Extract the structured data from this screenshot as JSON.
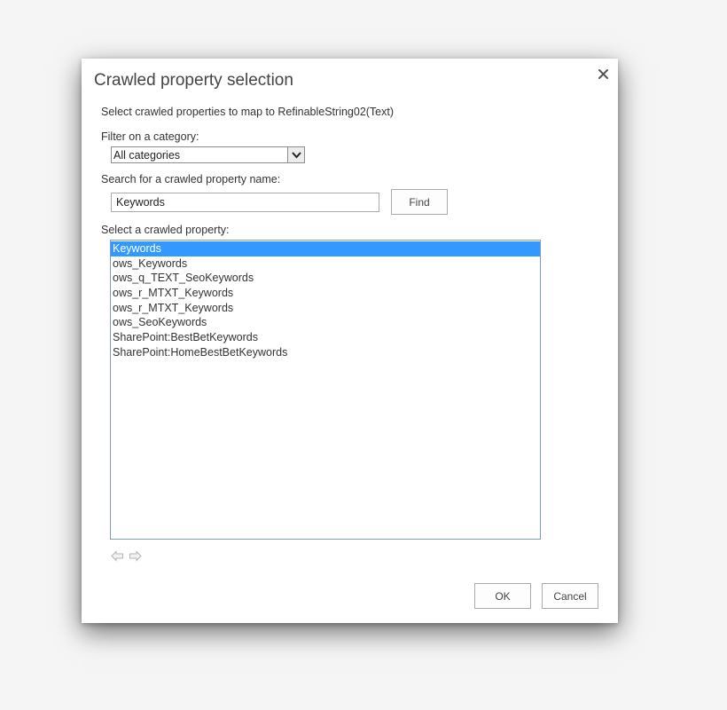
{
  "dialog": {
    "title": "Crawled property selection",
    "close_label": "Close"
  },
  "instructions": "Select crawled properties to map to RefinableString02(Text)",
  "filter": {
    "label": "Filter on a category:",
    "selected": "All categories"
  },
  "search": {
    "label": "Search for a crawled property name:",
    "value": "Keywords",
    "find_label": "Find"
  },
  "list": {
    "label": "Select a crawled property:",
    "items": [
      "Keywords",
      "ows_Keywords",
      "ows_q_TEXT_SeoKeywords",
      "ows_r_MTXT_Keywords",
      "ows_r_MTXT_Keywords",
      "ows_SeoKeywords",
      "SharePoint:BestBetKeywords",
      "SharePoint:HomeBestBetKeywords"
    ],
    "selected_index": 0
  },
  "pager": {
    "prev_icon": "arrow-left-icon",
    "next_icon": "arrow-right-icon"
  },
  "footer": {
    "ok_label": "OK",
    "cancel_label": "Cancel"
  },
  "colors": {
    "selection": "#3399ff",
    "list_border": "#7a9cc6"
  }
}
